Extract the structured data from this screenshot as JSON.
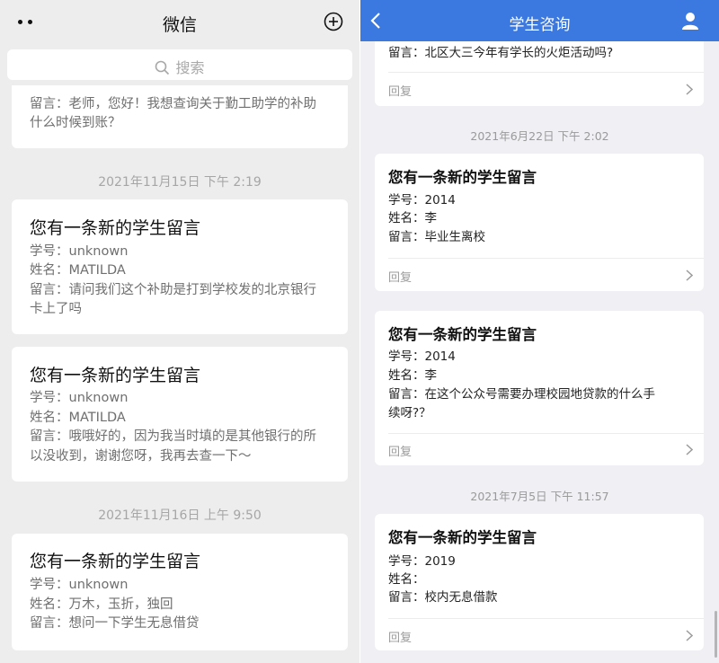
{
  "left": {
    "title": "微信",
    "search_placeholder": "搜索",
    "partial_card": {
      "line1": "留言：老师，您好！我想查询关于勤工助学的补助",
      "line2": "什么时候到账？"
    },
    "timestamp1": "2021年11月15日 下午 2:19",
    "card1": {
      "title": "您有一条新的学生留言",
      "line1": "学号：unknown",
      "line2": "姓名：MATILDA",
      "line3": "留言：请问我们这个补助是打到学校发的北京银行",
      "line4": "卡上了吗"
    },
    "card2": {
      "title": "您有一条新的学生留言",
      "line1": "学号：unknown",
      "line2": "姓名：MATILDA",
      "line3": "留言：哦哦好的，因为我当时填的是其他银行的所",
      "line4": "以没收到，谢谢您呀，我再去查一下～"
    },
    "timestamp2": "2021年11月16日 上午 9:50",
    "card3": {
      "title": "您有一条新的学生留言",
      "line1": "学号：unknown",
      "line2": "姓名：万木，玉折，独回",
      "line3": "留言：想问一下学生无息借贷"
    }
  },
  "right": {
    "title": "学生咨询",
    "partial_card": {
      "line1": "留言：北区大三今年有学长的火炬活动吗?",
      "reply": "回复"
    },
    "timestamp1": "2021年6月22日 下午 2:02",
    "card1": {
      "title": "您有一条新的学生留言",
      "line1": "学号：2014",
      "line2": "姓名：李",
      "line3": "留言：毕业生离校",
      "reply": "回复"
    },
    "card2": {
      "title": "您有一条新的学生留言",
      "line1": "学号：2014",
      "line2": "姓名：李",
      "line3": "留言：在这个公众号需要办理校园地贷款的什么手",
      "line4": "续呀?？",
      "reply": "回复"
    },
    "timestamp2": "2021年7月5日 下午 11:57",
    "card3": {
      "title": "您有一条新的学生留言",
      "line1": "学号：2019",
      "line2": "姓名：",
      "line3": "留言：校内无息借款",
      "reply": "回复"
    }
  },
  "colors": {
    "left_background": "#ededed",
    "right_header": "#3b78e0",
    "right_background": "#efeff4"
  },
  "icons": [
    "more-dots-icon",
    "add-circle-icon",
    "search-icon",
    "back-arrow-icon",
    "user-icon",
    "chevron-right-icon"
  ]
}
